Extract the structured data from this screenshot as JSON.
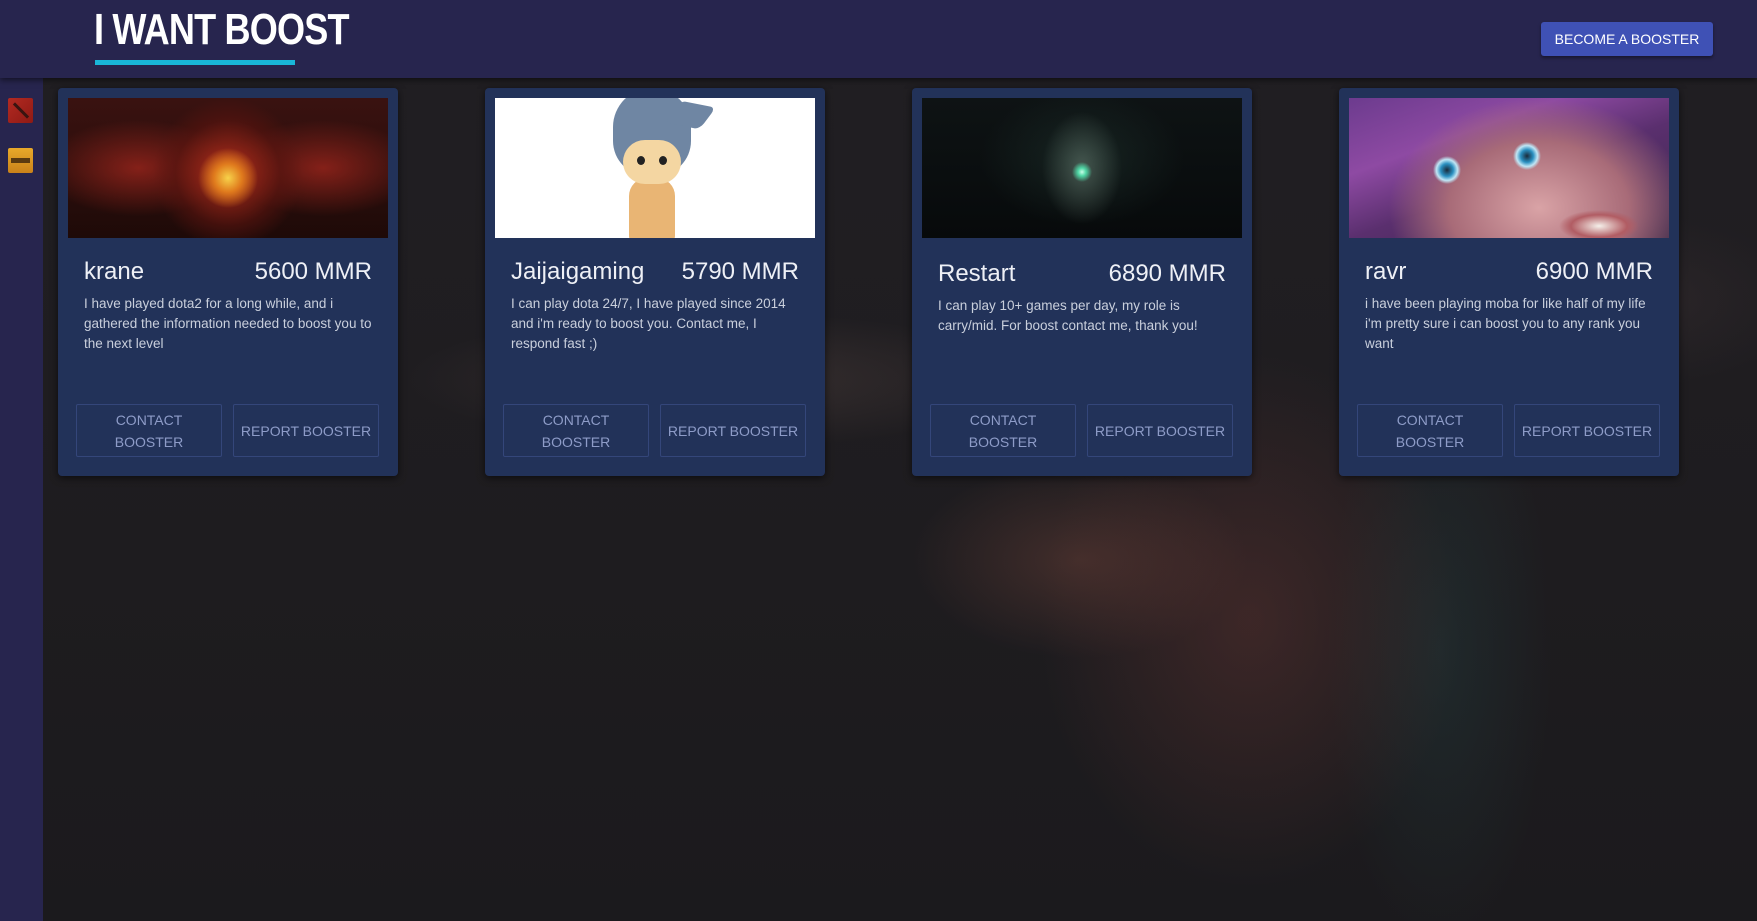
{
  "header": {
    "logo": "I WANT BOOST",
    "become_booster_label": "BECOME A BOOSTER"
  },
  "sidebar": {
    "items": [
      {
        "icon": "dota2-icon"
      },
      {
        "icon": "csgo-icon"
      }
    ]
  },
  "colors": {
    "header_bg": "#27254e",
    "card_bg": "#223259",
    "accent": "#19b6d8",
    "primary_button": "#3f51b5"
  },
  "boosters": [
    {
      "name": "krane",
      "mmr": "5600 MMR",
      "description": "I have played dota2 for a long while, and i gathered the information needed to boost you to the next level",
      "contact_label": "CONTACT BOOSTER",
      "report_label": "REPORT BOOSTER"
    },
    {
      "name": "Jaijaigaming",
      "mmr": "5790 MMR",
      "description": "I can play dota 24/7, I have played since 2014 and i'm ready to boost you. Contact me, I respond fast ;)",
      "contact_label": "CONTACT BOOSTER",
      "report_label": "REPORT BOOSTER"
    },
    {
      "name": "Restart",
      "mmr": "6890 MMR",
      "description": "I can play 10+ games per day, my role is carry/mid. For boost contact me, thank you!",
      "contact_label": "CONTACT BOOSTER",
      "report_label": "REPORT BOOSTER"
    },
    {
      "name": "ravr",
      "mmr": "6900 MMR",
      "description": "i have been playing moba for like half of my life i'm pretty sure i can boost you to any rank you want",
      "contact_label": "CONTACT BOOSTER",
      "report_label": "REPORT BOOSTER"
    }
  ]
}
